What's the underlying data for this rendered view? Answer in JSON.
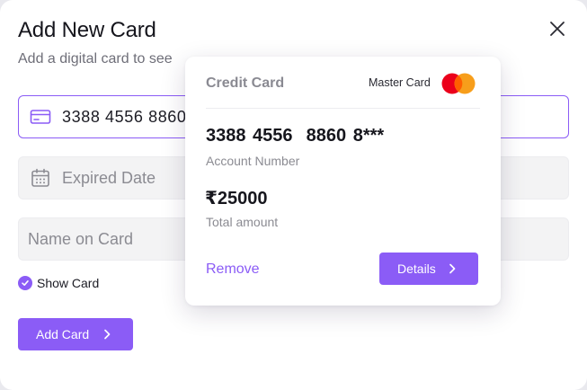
{
  "dialog": {
    "title": "Add New Card",
    "subtitle": "Add a digital card to see",
    "close_icon": "close-icon"
  },
  "form": {
    "card_number": {
      "value": "3388 4556 8860",
      "icon": "credit-card-icon"
    },
    "expired_date": {
      "placeholder": "Expired Date",
      "icon": "calendar-icon"
    },
    "name_on_card": {
      "placeholder": "Name on Card"
    },
    "show_card": {
      "label": "Show Card",
      "checked": true
    },
    "add_button": {
      "label": "Add Card",
      "icon": "chevron-right-icon"
    }
  },
  "popover": {
    "title": "Credit Card",
    "brand": "Master Card",
    "brand_logo": "mastercard-logo",
    "account_number": "3388 4556  8860 8***",
    "account_label": "Account Number",
    "currency_symbol": "₹",
    "amount": "25000",
    "amount_label": "Total amount",
    "remove_label": "Remove",
    "details_label": "Details"
  },
  "colors": {
    "accent": "#8b5cf6",
    "mastercard_red": "#eb001b",
    "mastercard_orange": "#f79e1b"
  }
}
